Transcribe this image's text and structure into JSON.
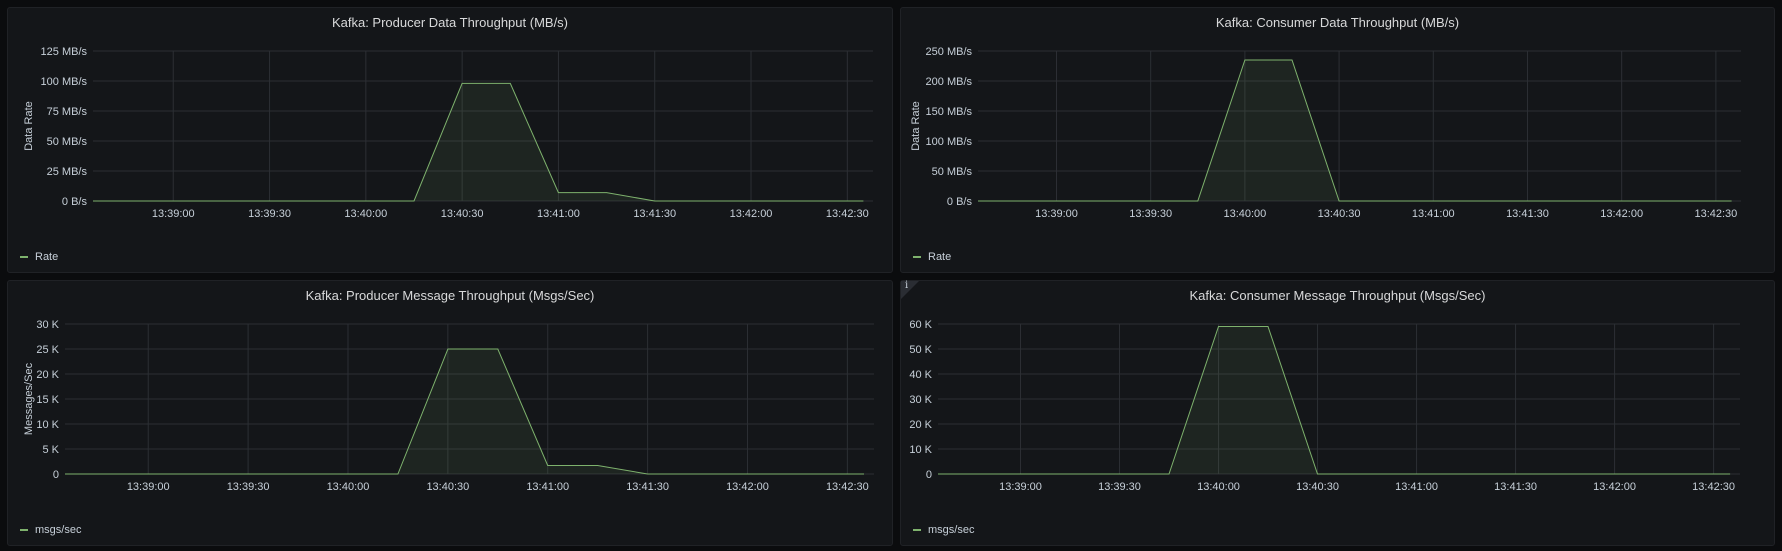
{
  "colors": {
    "series": "#7eb26d",
    "grid": "#2c2f34",
    "background": "#141619"
  },
  "panels": [
    {
      "title": "Kafka: Producer Data Throughput (MB/s)",
      "ylabel": "Data Rate",
      "legend": "Rate",
      "chart_data": {
        "type": "area",
        "title": "Kafka: Producer Data Throughput (MB/s)",
        "ylabel": "Data Rate",
        "xlabel": "",
        "ylim": [
          0,
          125
        ],
        "yunit": "MB/s",
        "y_ticks": [
          0,
          25,
          50,
          75,
          100,
          125
        ],
        "y_tick_labels": [
          "0 B/s",
          "25 MB/s",
          "50 MB/s",
          "75 MB/s",
          "100 MB/s",
          "125 MB/s"
        ],
        "x_tick_labels": [
          "13:39:00",
          "13:39:30",
          "13:40:00",
          "13:40:30",
          "13:41:00",
          "13:41:30",
          "13:42:00",
          "13:42:30"
        ],
        "x_tick_times": [
          "13:39:00",
          "13:39:30",
          "13:40:00",
          "13:40:30",
          "13:41:00",
          "13:41:30",
          "13:42:00",
          "13:42:30"
        ],
        "xlim": [
          "13:38:35",
          "13:42:38"
        ],
        "series": [
          {
            "name": "Rate",
            "x": [
              "13:38:35",
              "13:40:15",
              "13:40:30",
              "13:40:45",
              "13:41:00",
              "13:41:15",
              "13:41:30",
              "13:42:35"
            ],
            "values": [
              0,
              0,
              98,
              98,
              7,
              7,
              0,
              0
            ]
          }
        ]
      }
    },
    {
      "title": "Kafka: Consumer Data Throughput (MB/s)",
      "ylabel": "Data Rate",
      "legend": "Rate",
      "chart_data": {
        "type": "area",
        "title": "Kafka: Consumer Data Throughput (MB/s)",
        "ylabel": "Data Rate",
        "xlabel": "",
        "ylim": [
          0,
          250
        ],
        "yunit": "MB/s",
        "y_ticks": [
          0,
          50,
          100,
          150,
          200,
          250
        ],
        "y_tick_labels": [
          "0 B/s",
          "50 MB/s",
          "100 MB/s",
          "150 MB/s",
          "200 MB/s",
          "250 MB/s"
        ],
        "x_tick_labels": [
          "13:39:00",
          "13:39:30",
          "13:40:00",
          "13:40:30",
          "13:41:00",
          "13:41:30",
          "13:42:00",
          "13:42:30"
        ],
        "x_tick_times": [
          "13:39:00",
          "13:39:30",
          "13:40:00",
          "13:40:30",
          "13:41:00",
          "13:41:30",
          "13:42:00",
          "13:42:30"
        ],
        "xlim": [
          "13:38:35",
          "13:42:38"
        ],
        "series": [
          {
            "name": "Rate",
            "x": [
              "13:38:35",
              "13:39:45",
              "13:40:00",
              "13:40:15",
              "13:40:30",
              "13:42:35"
            ],
            "values": [
              0,
              0,
              235,
              235,
              0,
              0
            ]
          }
        ]
      }
    },
    {
      "title": "Kafka: Producer Message Throughput (Msgs/Sec)",
      "ylabel": "Messages/Sec",
      "legend": "msgs/sec",
      "chart_data": {
        "type": "area",
        "title": "Kafka: Producer Message Throughput (Msgs/Sec)",
        "ylabel": "Messages/Sec",
        "xlabel": "",
        "ylim": [
          0,
          30000
        ],
        "y_ticks": [
          0,
          5000,
          10000,
          15000,
          20000,
          25000,
          30000
        ],
        "y_tick_labels": [
          "0",
          "5 K",
          "10 K",
          "15 K",
          "20 K",
          "25 K",
          "30 K"
        ],
        "x_tick_labels": [
          "13:39:00",
          "13:39:30",
          "13:40:00",
          "13:40:30",
          "13:41:00",
          "13:41:30",
          "13:42:00",
          "13:42:30"
        ],
        "x_tick_times": [
          "13:39:00",
          "13:39:30",
          "13:40:00",
          "13:40:30",
          "13:41:00",
          "13:41:30",
          "13:42:00",
          "13:42:30"
        ],
        "xlim": [
          "13:38:35",
          "13:42:38"
        ],
        "series": [
          {
            "name": "msgs/sec",
            "x": [
              "13:38:35",
              "13:40:15",
              "13:40:30",
              "13:40:45",
              "13:41:00",
              "13:41:15",
              "13:41:30",
              "13:42:35"
            ],
            "values": [
              0,
              0,
              25000,
              25000,
              1700,
              1700,
              0,
              0
            ]
          }
        ]
      }
    },
    {
      "title": "Kafka: Consumer Message Throughput (Msgs/Sec)",
      "ylabel": "",
      "legend": "msgs/sec",
      "info_icon": "i",
      "chart_data": {
        "type": "area",
        "title": "Kafka: Consumer Message Throughput (Msgs/Sec)",
        "ylabel": "",
        "xlabel": "",
        "ylim": [
          0,
          60000
        ],
        "y_ticks": [
          0,
          10000,
          20000,
          30000,
          40000,
          50000,
          60000
        ],
        "y_tick_labels": [
          "0",
          "10 K",
          "20 K",
          "30 K",
          "40 K",
          "50 K",
          "60 K"
        ],
        "x_tick_labels": [
          "13:39:00",
          "13:39:30",
          "13:40:00",
          "13:40:30",
          "13:41:00",
          "13:41:30",
          "13:42:00",
          "13:42:30"
        ],
        "x_tick_times": [
          "13:39:00",
          "13:39:30",
          "13:40:00",
          "13:40:30",
          "13:41:00",
          "13:41:30",
          "13:42:00",
          "13:42:30"
        ],
        "xlim": [
          "13:38:35",
          "13:42:38"
        ],
        "series": [
          {
            "name": "msgs/sec",
            "x": [
              "13:38:35",
              "13:39:45",
              "13:40:00",
              "13:40:15",
              "13:40:30",
              "13:42:35"
            ],
            "values": [
              0,
              0,
              59000,
              59000,
              0,
              0
            ]
          }
        ]
      }
    }
  ]
}
